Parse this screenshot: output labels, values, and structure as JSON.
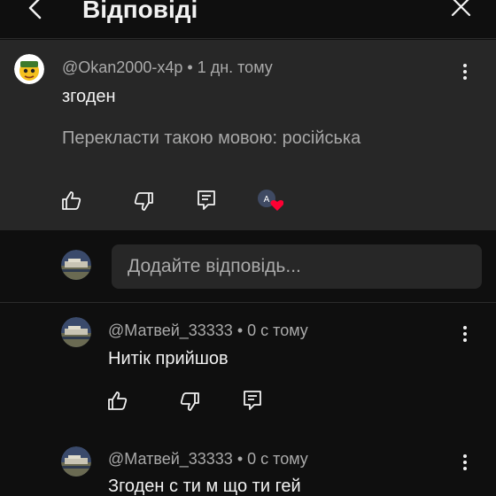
{
  "header": {
    "title": "Відповіді"
  },
  "parent_comment": {
    "author": "@Okan2000-x4p",
    "time": "1 дн. тому",
    "text": "згоден",
    "translate": "Перекласти такою мовою: російська",
    "creator_heart_initial": "A"
  },
  "reply_box": {
    "placeholder": "Додайте відповідь..."
  },
  "replies": [
    {
      "author": "@Матвей_33333",
      "time": "0 с тому",
      "text": "Нитік прийшов"
    },
    {
      "author": "@Матвей_33333",
      "time": "0 с тому",
      "text": "Згоден с ти м що ти гей"
    }
  ],
  "colors": {
    "background": "#0f0f0f",
    "highlight": "#272727",
    "heart": "#ff0033"
  },
  "icons": {
    "back": "chevron-left-icon",
    "close": "close-icon",
    "like": "thumbs-up-icon",
    "dislike": "thumbs-down-icon",
    "reply": "reply-comment-icon",
    "more": "more-vert-icon"
  }
}
